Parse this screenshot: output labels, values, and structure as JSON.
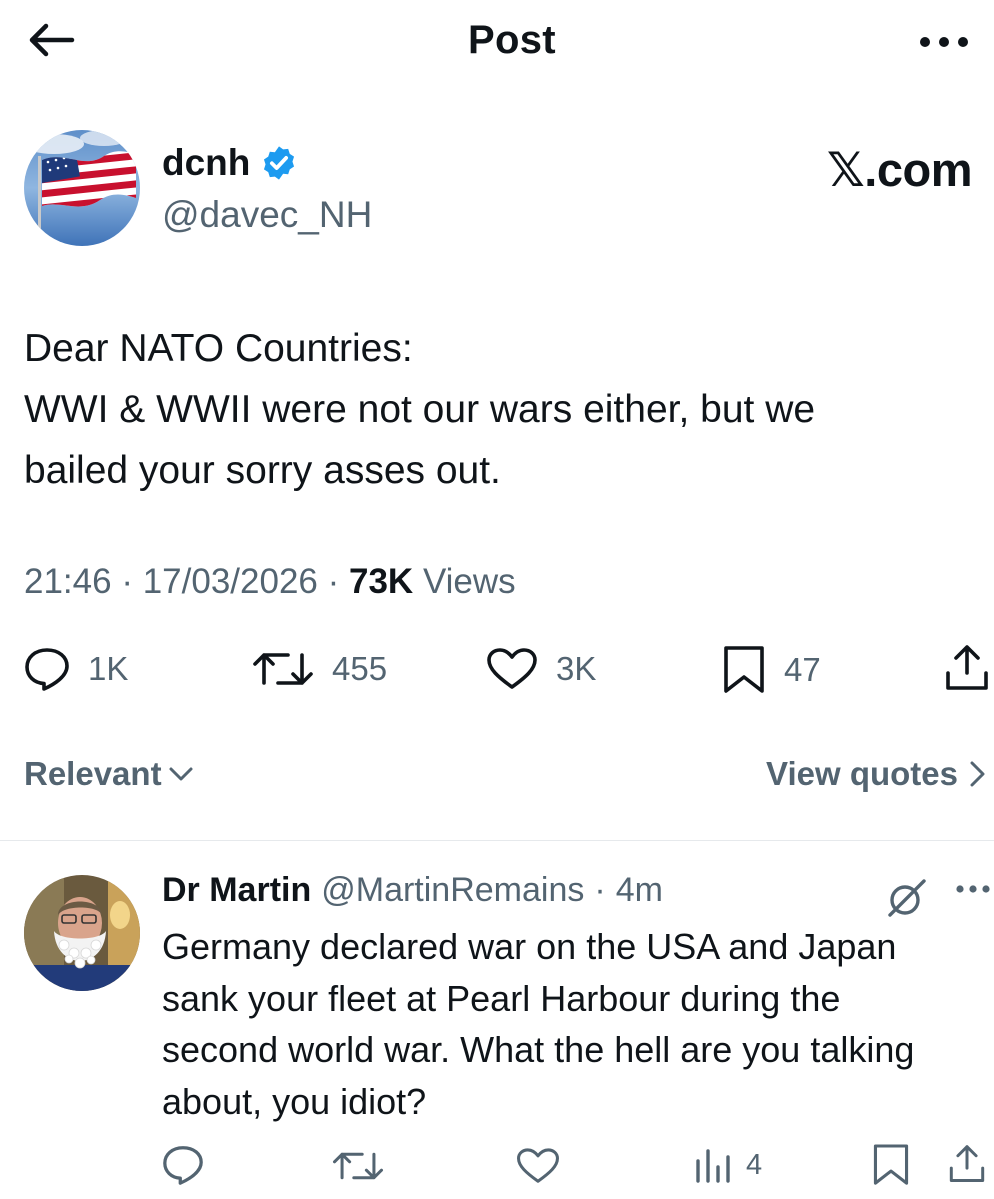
{
  "header": {
    "title": "Post",
    "back_icon": "arrow-left-icon",
    "more_icon": "more-horizontal-icon"
  },
  "post": {
    "author_name": "dcnh",
    "author_handle": "@davec_NH",
    "verified_color": "#1d9bf0",
    "watermark": "𝕏.com",
    "text_lines": [
      "Dear NATO Countries:",
      "WWI & WWII were not our wars either, but we",
      "bailed your sorry asses out."
    ],
    "time": "21:46",
    "date": "17/03/2026",
    "views_count": "73K",
    "views_label": "Views",
    "actions": {
      "replies": "1K",
      "reposts": "455",
      "likes": "3K",
      "bookmarks": "47"
    }
  },
  "sort": {
    "label": "Relevant",
    "view_quotes": "View quotes"
  },
  "reply": {
    "author_name": "Dr Martin",
    "author_handle": "@MartinRemains",
    "time": "4m",
    "text_lines": [
      "Germany declared war on the USA and Japan",
      "sank your fleet at Pearl Harbour during the",
      "second world war. What the hell are you talking",
      "about, you idiot?"
    ],
    "views": "4"
  },
  "colors": {
    "text": "#0f1419",
    "secondary": "#536471",
    "divider": "#e6e9ec"
  }
}
